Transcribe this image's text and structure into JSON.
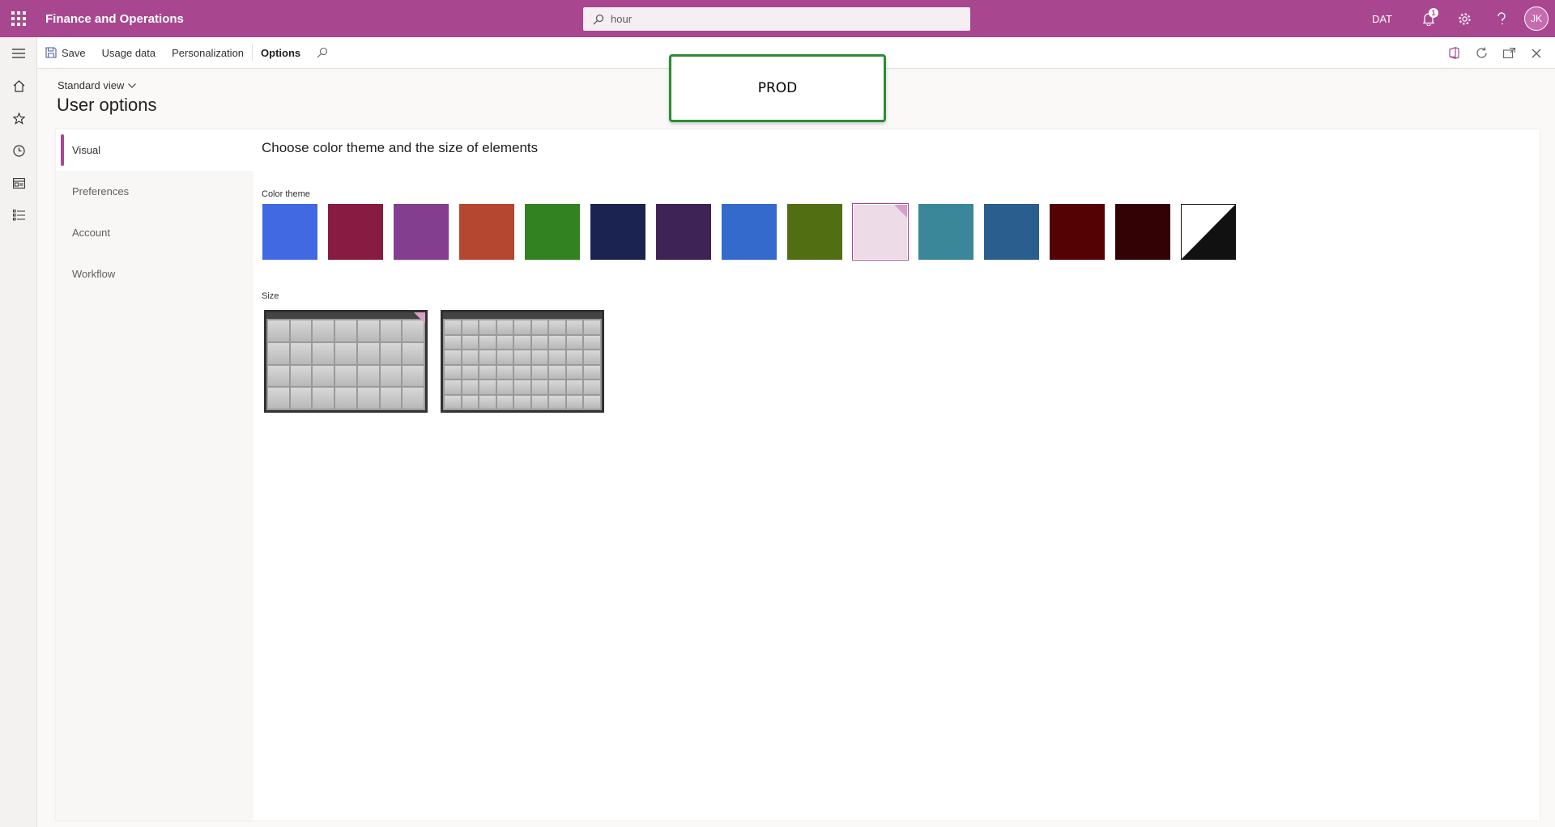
{
  "topbar": {
    "app_title": "Finance and Operations",
    "search_value": "hour",
    "company": "DAT",
    "notification_count": "1",
    "user_initials": "JK",
    "brand_color": "#a8478f"
  },
  "action_pane": {
    "save_label": "Save",
    "usage_data_label": "Usage data",
    "personalization_label": "Personalization",
    "options_label": "Options"
  },
  "environment_banner": "PROD",
  "page": {
    "view_label": "Standard view",
    "title": "User options"
  },
  "tabs": [
    {
      "label": "Visual",
      "active": true
    },
    {
      "label": "Preferences",
      "active": false
    },
    {
      "label": "Account",
      "active": false
    },
    {
      "label": "Workflow",
      "active": false
    }
  ],
  "visual": {
    "heading": "Choose color theme and the size of elements",
    "color_theme_label": "Color theme",
    "color_themes": [
      {
        "color": "#4169e1",
        "selected": false
      },
      {
        "color": "#871b42",
        "selected": false
      },
      {
        "color": "#843e8f",
        "selected": false
      },
      {
        "color": "#b5462f",
        "selected": false
      },
      {
        "color": "#338222",
        "selected": false
      },
      {
        "color": "#1b2351",
        "selected": false
      },
      {
        "color": "#3e2357",
        "selected": false
      },
      {
        "color": "#336acc",
        "selected": false
      },
      {
        "color": "#516f12",
        "selected": false
      },
      {
        "color": "#eddbe8",
        "selected": true
      },
      {
        "color": "#3a8799",
        "selected": false
      },
      {
        "color": "#2a5e8e",
        "selected": false
      },
      {
        "color": "#550205",
        "selected": false
      },
      {
        "color": "#320204",
        "selected": false
      },
      {
        "color": "high-contrast",
        "selected": false
      }
    ],
    "size_label": "Size",
    "size_options": [
      {
        "name": "normal",
        "selected": true
      },
      {
        "name": "dense",
        "selected": false
      }
    ]
  }
}
